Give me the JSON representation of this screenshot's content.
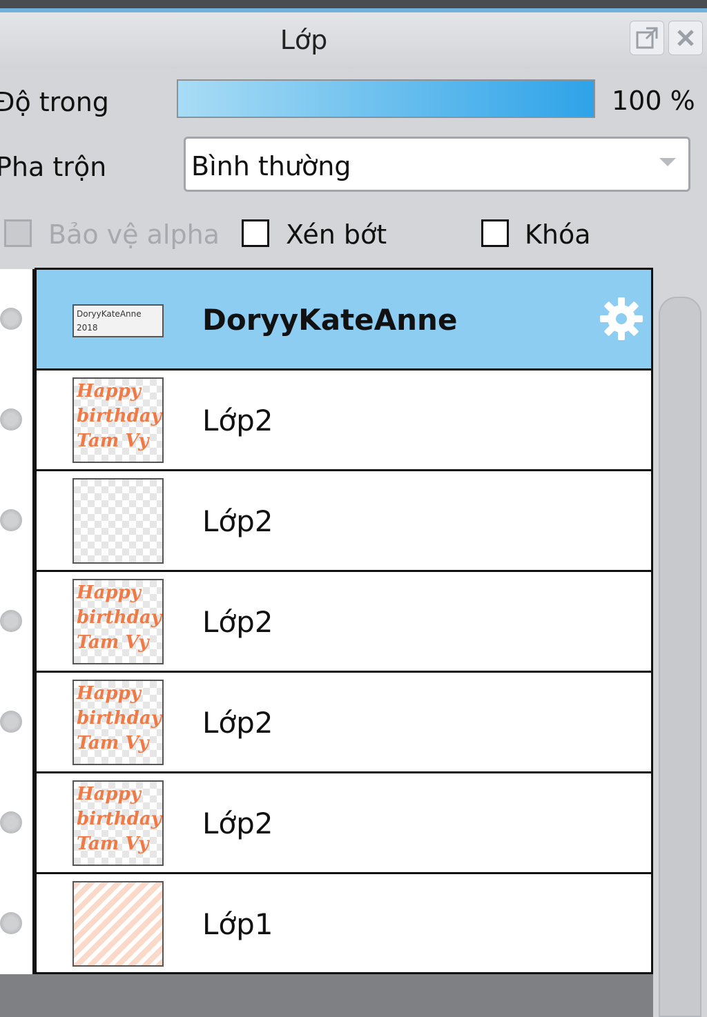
{
  "panel": {
    "title": "Lớp",
    "opacity_label": "Độ trong",
    "opacity_value": "100 %",
    "opacity_fraction": 1.0,
    "blend_label": "Pha trộn",
    "blend_value": "Bình thường",
    "checkboxes": [
      {
        "label": "Bảo vệ alpha",
        "checked": false,
        "disabled": true
      },
      {
        "label": "Xén bớt",
        "checked": false,
        "disabled": false
      },
      {
        "label": "Khóa",
        "checked": false,
        "disabled": false
      }
    ]
  },
  "layers": [
    {
      "name": "DoryyKateAnne",
      "selected": true,
      "thumb_text": "DoryyKateAnne 2018"
    },
    {
      "name": "Lớp2",
      "selected": false,
      "thumb_text": "Happy birthday Tam Vy"
    },
    {
      "name": "Lớp2",
      "selected": false,
      "thumb_text": ""
    },
    {
      "name": "Lớp2",
      "selected": false,
      "thumb_text": "Happy birthday Tam Vy"
    },
    {
      "name": "Lớp2",
      "selected": false,
      "thumb_text": "Happy birthday Tam Vy"
    },
    {
      "name": "Lớp2",
      "selected": false,
      "thumb_text": "Happy birthday Tam Vy"
    },
    {
      "name": "Lớp1",
      "selected": false,
      "thumb_text": ""
    }
  ],
  "colors": {
    "selected_row": "#8dcdf1",
    "thumb_text": "#f07a45"
  },
  "icons": {
    "popout": "popout-icon",
    "close": "close-icon",
    "settings": "gear-icon",
    "visibility": "eye-icon"
  }
}
